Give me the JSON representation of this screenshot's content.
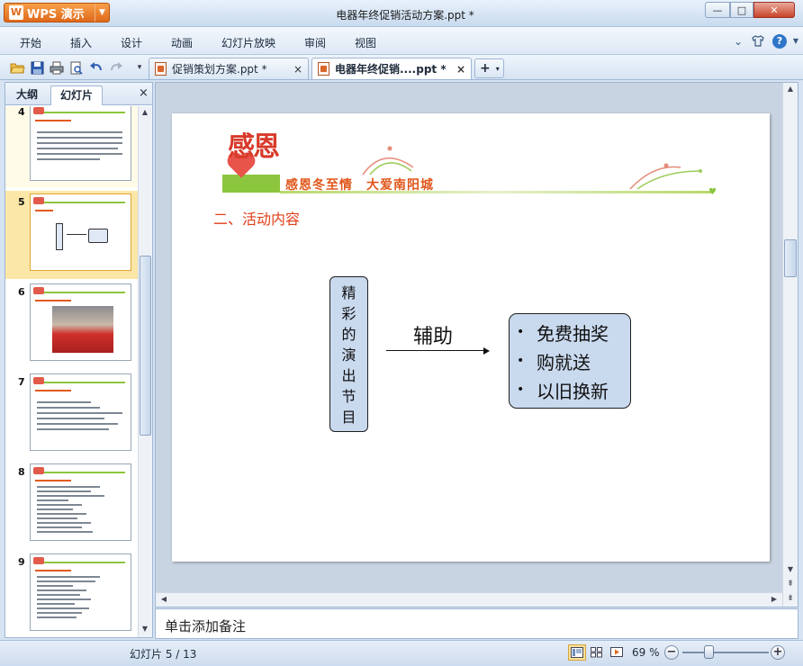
{
  "app": {
    "name": "WPS 演示",
    "logo_char": "W",
    "window_title": "电器年终促销活动方案.ppt *"
  },
  "window_controls": {
    "minimize": "—",
    "maximize": "□",
    "close": "✕"
  },
  "menu": [
    "开始",
    "插入",
    "设计",
    "动画",
    "幻灯片放映",
    "审阅",
    "视图"
  ],
  "tabs": [
    {
      "label": "促销策划方案.ppt *",
      "close": "×"
    },
    {
      "label": "电器年终促销....ppt *",
      "close": "×"
    }
  ],
  "tab_add": {
    "plus": "+",
    "dropdown": "▾"
  },
  "left_panel": {
    "tabs": [
      "大纲",
      "幻灯片"
    ],
    "close": "×",
    "slides": [
      {
        "number": "4"
      },
      {
        "number": "5"
      },
      {
        "number": "6"
      },
      {
        "number": "7"
      },
      {
        "number": "8"
      },
      {
        "number": "9"
      }
    ]
  },
  "slide": {
    "logo_text": "感恩",
    "banner": "感恩冬至情　大爱南阳城",
    "heading": "二、活动内容",
    "vertical_box": "精彩的演出节目",
    "arrow_label": "辅助",
    "list_bullet": "•",
    "list": [
      "免费抽奖",
      "购就送",
      "以旧换新"
    ]
  },
  "notes": {
    "placeholder": "单击添加备注"
  },
  "status": {
    "slide_counter": "幻灯片 5 / 13",
    "zoom": "69 %",
    "zoom_minus": "−",
    "zoom_plus": "+",
    "zoom_fraction": 0.31
  },
  "colors": {
    "accent": "#e0691b",
    "heading_red": "#e0401a",
    "box_fill": "#c9d9ee",
    "band_green": "#8cc63f"
  }
}
